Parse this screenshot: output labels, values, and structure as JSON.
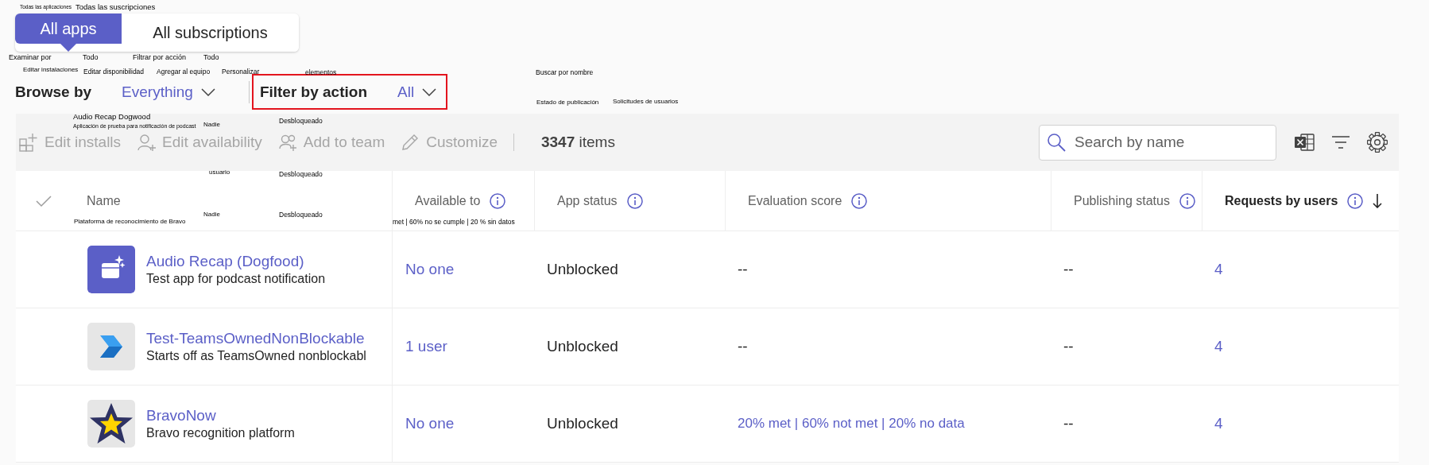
{
  "top_tabs": [
    {
      "label": "All apps",
      "selected": true
    },
    {
      "label": "All subscriptions",
      "selected": false
    }
  ],
  "browse": {
    "label": "Browse by",
    "value": "Everything"
  },
  "filter": {
    "label": "Filter by action",
    "value": "All",
    "highlighted": true
  },
  "toolbar": {
    "actions": [
      {
        "label": "Edit installs",
        "kind": "grid",
        "disabled": true
      },
      {
        "label": "Edit availability",
        "kind": "person",
        "disabled": true
      },
      {
        "label": "Add to team",
        "kind": "people",
        "disabled": true
      },
      {
        "label": "Customize",
        "kind": "pencil",
        "disabled": true
      }
    ],
    "count": "**3347** items",
    "search": {
      "placeholder": "Search by name"
    }
  },
  "table": {
    "columns": [
      {
        "label": "Name",
        "info": false,
        "sorted": false
      },
      {
        "label": "Available to",
        "info": true,
        "sorted": false
      },
      {
        "label": "App status",
        "info": true,
        "sorted": false
      },
      {
        "label": "Evaluation score",
        "info": true,
        "sorted": false
      },
      {
        "label": "Publishing status",
        "info": true,
        "sorted": false
      },
      {
        "label": "Requests by users",
        "info": true,
        "sorted": true
      }
    ],
    "rows": [
      {
        "name": "Audio Recap (Dogfood)",
        "description": "Test app for podcast notification",
        "kind": "podcast",
        "available_to": "No one",
        "app_status": "Unblocked",
        "evaluation": {
          "text": "--",
          "kind": "text"
        },
        "publishing_status": "--",
        "requests": "4"
      },
      {
        "name": "Test-TeamsOwnedNonBlockable",
        "description": "Starts off as TeamsOwned nonblockabl",
        "kind": "chevron",
        "available_to": "1 user",
        "app_status": "Unblocked",
        "evaluation": {
          "text": "--",
          "kind": "text"
        },
        "publishing_status": "--",
        "requests": "4"
      },
      {
        "name": "BravoNow",
        "description": "Bravo recognition platform",
        "kind": "star",
        "available_to": "No one",
        "app_status": "Unblocked",
        "evaluation": {
          "text": "20% met | 60% not met | 20% no data",
          "kind": "link"
        },
        "publishing_status": "--",
        "requests": "4"
      }
    ]
  },
  "overlay_labels": [
    "Todas las aplicaciones",
    "Todas las suscripciones",
    "Examinar por",
    "Todo",
    "Filtrar por acción",
    "Todo",
    "Editar instalaciones",
    "Editar disponibilidad",
    "Agregar al equipo",
    "Personalizar",
    "elementos",
    "Buscar por nombre",
    "Estado de publicación",
    "Solicitudes de usuarios",
    "Audio Recap Dogwood",
    "Aplicación de prueba para notificación de podcast",
    "Nadie",
    "Desbloqueado",
    "usuario",
    "Desbloqueado",
    "Nadie",
    "Desbloqueado",
    "Plataforma de reconocimiento de Bravo",
    "met | 60% no se cumple | 20 % sin datos"
  ]
}
